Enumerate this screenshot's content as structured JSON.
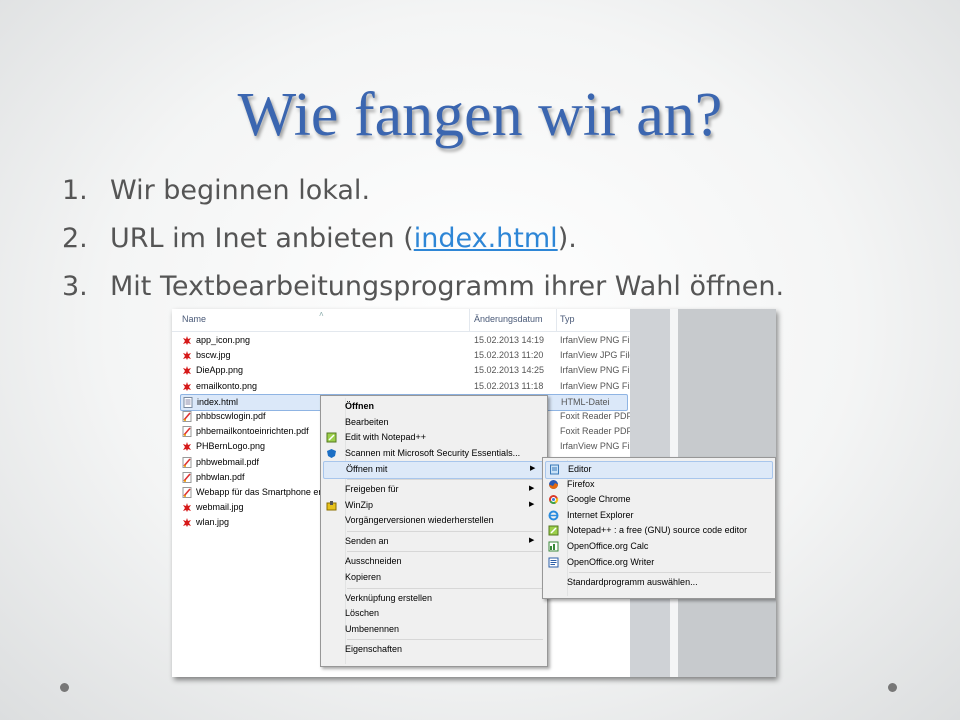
{
  "slide": {
    "title": "Wie fangen wir an?",
    "bullets": [
      {
        "num": "1.",
        "text": "Wir beginnen lokal."
      },
      {
        "num": "2.",
        "pre": "URL im Inet anbieten (",
        "link": "index.html",
        "post": ")."
      },
      {
        "num": "3.",
        "text": "Mit Textbearbeitungsprogramm ihrer Wahl öffnen."
      }
    ]
  },
  "explorer": {
    "columns": {
      "name": "Name",
      "date": "Änderungsdatum",
      "type": "Typ"
    },
    "files": [
      {
        "name": "app_icon.png",
        "date": "15.02.2013 14:19",
        "type": "IrfanView PNG File",
        "icon": "irfanview-icon"
      },
      {
        "name": "bscw.jpg",
        "date": "15.02.2013 11:20",
        "type": "IrfanView JPG File",
        "icon": "irfanview-icon"
      },
      {
        "name": "DieApp.png",
        "date": "15.02.2013 14:25",
        "type": "IrfanView PNG File",
        "icon": "irfanview-icon"
      },
      {
        "name": "emailkonto.png",
        "date": "15.02.2013 11:18",
        "type": "IrfanView PNG File",
        "icon": "irfanview-icon"
      },
      {
        "name": "index.html",
        "date": "",
        "type": "HTML-Datei",
        "icon": "html-file-icon",
        "selected": true
      },
      {
        "name": "phbbscwlogin.pdf",
        "date": "",
        "type": "Foxit Reader PDF ...",
        "icon": "pdf-icon"
      },
      {
        "name": "phbemailkontoeinrichten.pdf",
        "date": "",
        "type": "Foxit Reader PDF ...",
        "icon": "pdf-icon"
      },
      {
        "name": "PHBernLogo.png",
        "date": "",
        "type": "IrfanView PNG File",
        "icon": "irfanview-icon"
      },
      {
        "name": "phbwebmail.pdf",
        "date": "",
        "type": "",
        "icon": "pdf-icon"
      },
      {
        "name": "phbwlan.pdf",
        "date": "",
        "type": "",
        "icon": "pdf-icon"
      },
      {
        "name": "Webapp für das Smartphone erst",
        "date": "",
        "type": "",
        "icon": "pdf-icon"
      },
      {
        "name": "webmail.jpg",
        "date": "",
        "type": "",
        "icon": "irfanview-icon"
      },
      {
        "name": "wlan.jpg",
        "date": "",
        "type": "",
        "icon": "irfanview-icon"
      }
    ]
  },
  "context_menu": {
    "items": [
      {
        "label": "Öffnen",
        "bold": true
      },
      {
        "label": "Bearbeiten"
      },
      {
        "label": "Edit with Notepad++",
        "icon": "notepad-plus-icon"
      },
      {
        "label": "Scannen mit Microsoft Security Essentials...",
        "icon": "security-essentials-icon"
      },
      {
        "label": "Öffnen mit",
        "submenu": true,
        "highlighted": true
      },
      {
        "sep": true
      },
      {
        "label": "Freigeben für",
        "submenu": true
      },
      {
        "label": "WinZip",
        "submenu": true,
        "icon": "winzip-icon"
      },
      {
        "label": "Vorgängerversionen wiederherstellen"
      },
      {
        "sep": true
      },
      {
        "label": "Senden an",
        "submenu": true
      },
      {
        "sep": true
      },
      {
        "label": "Ausschneiden"
      },
      {
        "label": "Kopieren"
      },
      {
        "sep": true
      },
      {
        "label": "Verknüpfung erstellen"
      },
      {
        "label": "Löschen"
      },
      {
        "label": "Umbenennen"
      },
      {
        "sep": true
      },
      {
        "label": "Eigenschaften"
      }
    ]
  },
  "open_with_menu": {
    "items": [
      {
        "label": "Editor",
        "icon": "notepad-icon",
        "highlighted": true
      },
      {
        "label": "Firefox",
        "icon": "firefox-icon"
      },
      {
        "label": "Google Chrome",
        "icon": "chrome-icon"
      },
      {
        "label": "Internet Explorer",
        "icon": "internet-explorer-icon"
      },
      {
        "label": "Notepad++ : a free (GNU) source code editor",
        "icon": "notepad-plus-icon"
      },
      {
        "label": "OpenOffice.org Calc",
        "icon": "openoffice-calc-icon"
      },
      {
        "label": "OpenOffice.org Writer",
        "icon": "openoffice-writer-icon"
      },
      {
        "sep": true
      },
      {
        "label": "Standardprogramm auswählen..."
      }
    ]
  }
}
